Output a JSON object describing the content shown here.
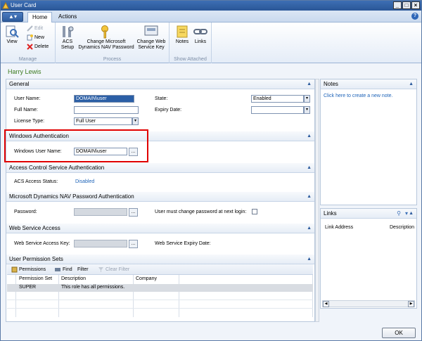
{
  "window": {
    "title": "User Card"
  },
  "ribbon": {
    "tabs": [
      "Home",
      "Actions"
    ],
    "buttons": {
      "view": "View",
      "edit": "Edit",
      "new": "New",
      "delete": "Delete",
      "acs_setup_1": "ACS",
      "acs_setup_2": "Setup",
      "change_pw_1": "Change Microsoft",
      "change_pw_2": "Dynamics NAV Password",
      "change_ws_1": "Change Web",
      "change_ws_2": "Service Key",
      "notes": "Notes",
      "links": "Links"
    },
    "groups": {
      "manage": "Manage",
      "process": "Process",
      "show_attached": "Show Attached"
    }
  },
  "record_name": "Harry Lewis",
  "general": {
    "title": "General",
    "user_name_label": "User Name:",
    "user_name": "DOMAIN\\user",
    "full_name_label": "Full Name:",
    "full_name": "",
    "license_type_label": "License Type:",
    "license_type": "Full User",
    "state_label": "State:",
    "state": "Enabled",
    "expiry_date_label": "Expiry Date:",
    "expiry_date": ""
  },
  "windows_auth": {
    "title": "Windows Authentication",
    "user_name_label": "Windows User Name:",
    "user_name": "DOMAIN\\user"
  },
  "acs": {
    "title": "Access Control Service Authentication",
    "status_label": "ACS Access Status:",
    "status": "Disabled"
  },
  "nav_password": {
    "title": "Microsoft Dynamics NAV Password Authentication",
    "password_label": "Password:",
    "must_change_label": "User must change password at next login:"
  },
  "web_service": {
    "title": "Web Service Access",
    "key_label": "Web Service Access Key:",
    "expiry_label": "Web Service Expiry Date:"
  },
  "permission_sets": {
    "title": "User Permission Sets",
    "toolbar": {
      "permissions": "Permissions",
      "find": "Find",
      "filter": "Filter",
      "clear_filter": "Clear Filter"
    },
    "columns": [
      "Permission Set",
      "Description",
      "Company"
    ],
    "rows": [
      {
        "set": "SUPER",
        "description": "This role has all permissions.",
        "company": ""
      }
    ]
  },
  "notes": {
    "title": "Notes",
    "link": "Click here to create a new note."
  },
  "links": {
    "title": "Links",
    "columns": [
      "Link Address",
      "Description"
    ]
  },
  "footer": {
    "ok": "OK"
  },
  "icons": [
    "app-icon",
    "view-icon",
    "edit-icon",
    "new-icon",
    "delete-icon",
    "acs-setup-icon",
    "key-icon",
    "web-key-icon",
    "notes-icon",
    "links-icon",
    "help-icon",
    "permissions-icon",
    "find-icon",
    "clear-filter-icon",
    "search-icon",
    "links-menu-icon"
  ],
  "colors": {
    "accent": "#2b5fa6",
    "record_name": "#3c7b1f",
    "highlight_box": "#e00000",
    "link": "#1d63b8"
  }
}
